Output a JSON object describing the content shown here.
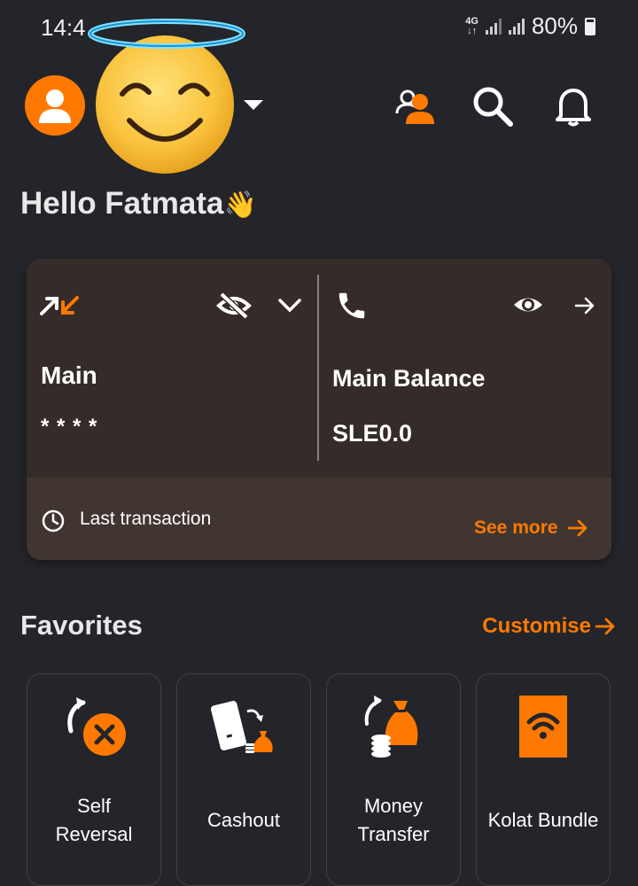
{
  "status_bar": {
    "time": "14:4",
    "network": "4G",
    "battery": "80%"
  },
  "header": {
    "greeting": "Hello Fatmata",
    "greeting_emoji": "👋",
    "icons": [
      "account-switch-icon",
      "search-icon",
      "bell-icon"
    ]
  },
  "balance_card": {
    "left": {
      "title": "Main",
      "masked_value": "* * * *"
    },
    "right": {
      "title": "Main Balance",
      "value": "SLE0.0"
    },
    "footer": {
      "last_transaction": "Last transaction",
      "see_more": "See more"
    }
  },
  "favorites": {
    "title": "Favorites",
    "customise": "Customise",
    "tiles": [
      {
        "line1": "Self",
        "line2": "Reversal"
      },
      {
        "line1": "Cashout",
        "line2": ""
      },
      {
        "line1": "Money",
        "line2": "Transfer"
      },
      {
        "line1": "Kolat Bundle",
        "line2": ""
      }
    ]
  },
  "colors": {
    "accent": "#ff7900",
    "background": "#23252a",
    "card": "#352b28"
  }
}
